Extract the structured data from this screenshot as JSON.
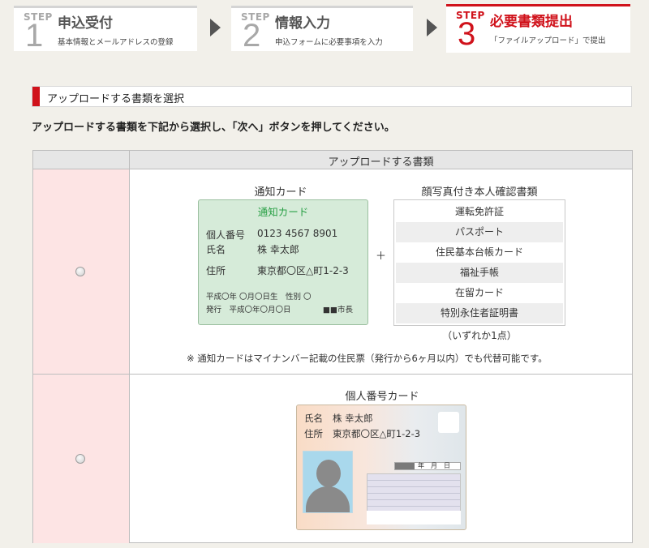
{
  "steps": [
    {
      "label": "STEP",
      "num": "1",
      "title": "申込受付",
      "sub": "基本情報とメールアドレスの登録"
    },
    {
      "label": "STEP",
      "num": "2",
      "title": "情報入力",
      "sub": "申込フォームに必要事項を入力"
    },
    {
      "label": "STEP",
      "num": "3",
      "title": "必要書類提出",
      "sub": "「ファイルアップロード」で提出"
    }
  ],
  "section_title": "アップロードする書類を選択",
  "instruction": "アップロードする書類を下記から選択し、「次へ」ボタンを押してください。",
  "table": {
    "header": "アップロードする書類",
    "option1": {
      "caption_left": "通知カード",
      "caption_right": "顔写真付き本人確認書類",
      "card": {
        "title": "通知カード",
        "num_label": "個人番号",
        "num_value": "0123 4567 8901",
        "name_label": "氏名",
        "name_value": "株 幸太郎",
        "addr_label": "住所",
        "addr_value": "東京都〇区△町1-2-3",
        "line1": "平成〇年 〇月〇日生　性別 〇",
        "line2": "発行　平成〇年〇月〇日",
        "issuer": "■■市長"
      },
      "plus": "＋",
      "id_items": [
        "運転免許証",
        "パスポート",
        "住民基本台帳カード",
        "福祉手帳",
        "在留カード",
        "特別永住者証明書"
      ],
      "id_note": "（いずれか1点）",
      "note": "※ 通知カードはマイナンバー記載の住民票（発行から6ヶ月以内）でも代替可能です。"
    },
    "option2": {
      "caption": "個人番号カード",
      "name_label": "氏名",
      "name_value": "株 幸太郎",
      "addr_label": "住所",
      "addr_value": "東京都〇区△町1-2-3",
      "date_text": "年　月　日"
    }
  }
}
